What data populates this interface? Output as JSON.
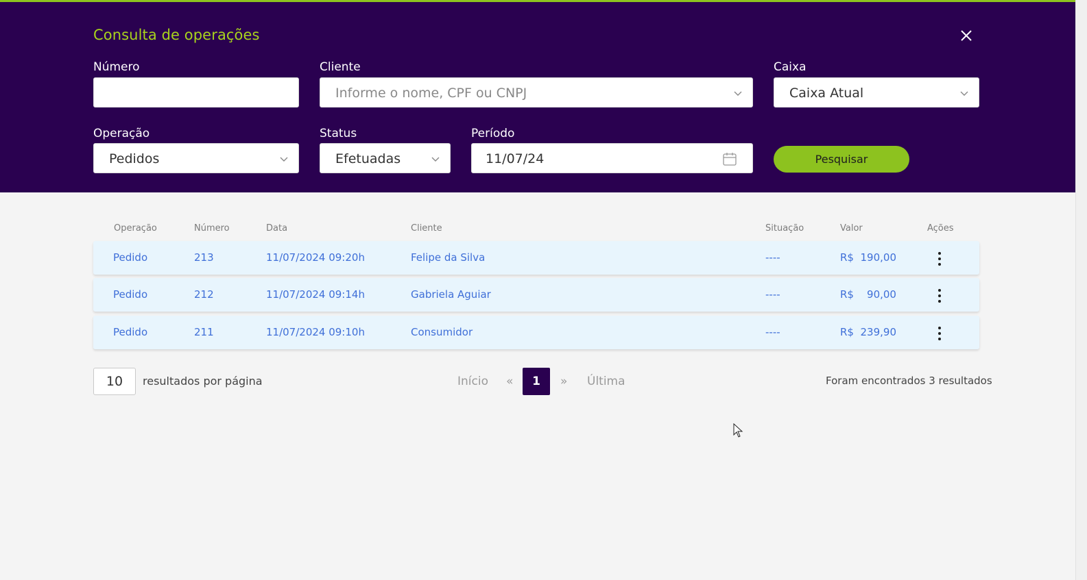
{
  "header": {
    "title": "Consulta de operações",
    "close_icon": "close-icon"
  },
  "filters": {
    "numero": {
      "label": "Número",
      "value": ""
    },
    "cliente": {
      "label": "Cliente",
      "placeholder": "Informe o nome, CPF ou CNPJ"
    },
    "caixa": {
      "label": "Caixa",
      "value": "Caixa Atual"
    },
    "operacao": {
      "label": "Operação",
      "value": "Pedidos"
    },
    "status": {
      "label": "Status",
      "value": "Efetuadas"
    },
    "periodo": {
      "label": "Período",
      "value": "11/07/24"
    },
    "search_label": "Pesquisar"
  },
  "table": {
    "columns": [
      "Operação",
      "Número",
      "Data",
      "Cliente",
      "Situação",
      "Valor",
      "Ações"
    ],
    "rows": [
      {
        "operacao": "Pedido",
        "numero": "213",
        "data": "11/07/2024 09:20h",
        "cliente": "Felipe da Silva",
        "situacao": "----",
        "valor": "R$  190,00"
      },
      {
        "operacao": "Pedido",
        "numero": "212",
        "data": "11/07/2024 09:14h",
        "cliente": "Gabriela Aguiar",
        "situacao": "----",
        "valor": "R$    90,00"
      },
      {
        "operacao": "Pedido",
        "numero": "211",
        "data": "11/07/2024 09:10h",
        "cliente": "Consumidor",
        "situacao": "----",
        "valor": "R$  239,90"
      }
    ]
  },
  "pagination": {
    "per_page": "10",
    "per_page_label": "resultados por página",
    "first": "Início",
    "prev": "«",
    "current": "1",
    "next": "»",
    "last": "Última",
    "result_count": "Foram encontrados 3 resultados"
  },
  "colors": {
    "header_bg": "#2a0150",
    "accent_green": "#8dc21f",
    "title_green": "#a8d31d",
    "row_bg": "#e8f5fd",
    "row_text": "#3f6fd8"
  }
}
